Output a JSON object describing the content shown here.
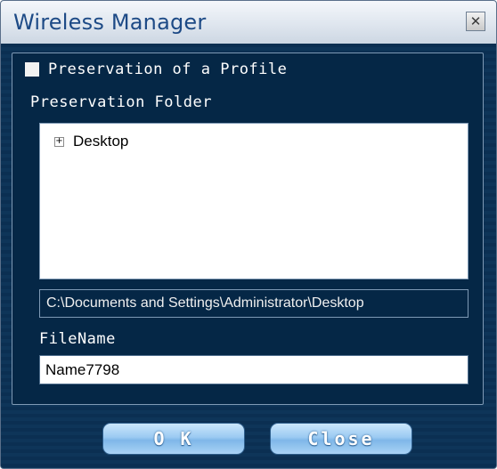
{
  "window": {
    "title": "Wireless Manager",
    "close_glyph": "✕"
  },
  "profile": {
    "checkbox_label": "Preservation of a Profile",
    "folder_label": "Preservation Folder",
    "tree": {
      "items": [
        {
          "expander": "+",
          "label": "Desktop"
        }
      ]
    },
    "path": "C:\\Documents and Settings\\Administrator\\Desktop",
    "filename_label": "FileName",
    "filename_value": "Name7798"
  },
  "buttons": {
    "ok_label": "O K",
    "close_label": "Close"
  },
  "colors": {
    "background_navy": "#0b2f52",
    "title_text": "#1d4a86",
    "button_blue": "#9bcaf2"
  },
  "icons": {
    "close": "close-icon",
    "expand": "plus-expander-icon"
  }
}
